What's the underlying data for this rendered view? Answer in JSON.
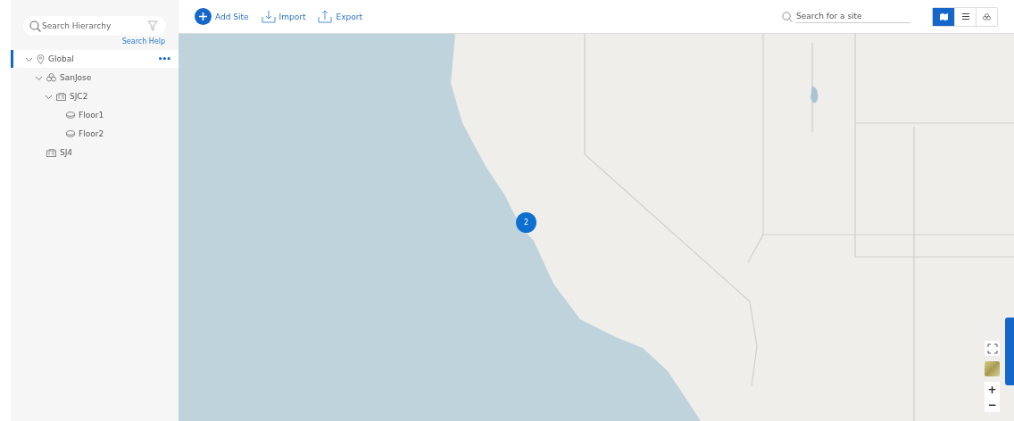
{
  "sidebar": {
    "search": {
      "placeholder": "Search Hierarchy"
    },
    "search_help": "Search Help",
    "tree": [
      {
        "label": "Global",
        "kind": "area",
        "expanded": true,
        "selected": true,
        "menu": "•••",
        "children": [
          {
            "label": "SanJose",
            "kind": "area-group",
            "expanded": true,
            "selected": false,
            "children": [
              {
                "label": "SJC2",
                "kind": "building",
                "expanded": true,
                "selected": false,
                "children": [
                  {
                    "label": "Floor1",
                    "kind": "floor",
                    "selected": false
                  },
                  {
                    "label": "Floor2",
                    "kind": "floor",
                    "selected": false
                  }
                ]
              }
            ]
          },
          {
            "label": "SJ4",
            "kind": "building",
            "selected": false
          }
        ]
      }
    ]
  },
  "toolbar": {
    "actions": [
      {
        "label": "Add Site",
        "kind": "add"
      },
      {
        "label": "Import",
        "kind": "import"
      },
      {
        "label": "Export",
        "kind": "export"
      }
    ],
    "site_search": {
      "placeholder": "Search for a site"
    },
    "views": [
      {
        "kind": "map",
        "selected": true
      },
      {
        "kind": "list",
        "selected": false
      },
      {
        "kind": "hierarchy",
        "selected": false
      }
    ]
  },
  "map": {
    "cluster_count": "2",
    "zoom_in": "+",
    "zoom_out": "−"
  }
}
